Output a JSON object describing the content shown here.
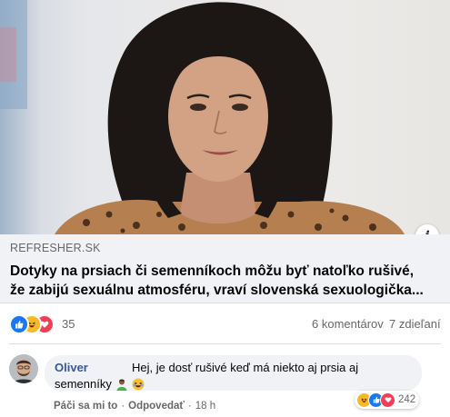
{
  "link_preview": {
    "source": "REFRESHER.SK",
    "headline_line1": "Dotyky na prsiach či semenníkoch môžu byť natoľko rušivé,",
    "headline_line2": "že zabijú sexuálnu atmosféru, vraví slovenská sexuologička..."
  },
  "post_stats": {
    "reaction_icons": [
      "like-icon",
      "haha-icon",
      "love-icon"
    ],
    "reaction_count": "35",
    "comments": "6 komentárov",
    "shares": "7 zdieľaní"
  },
  "comment": {
    "author": "Oliver",
    "text_line1": "Hej, je dosť rušivé keď má niekto aj prsia aj",
    "text_line2": "semenníky",
    "emojis": [
      "person-emoji",
      "laughing-emoji"
    ],
    "reaction_count": "242",
    "actions": {
      "like": "Páči sa mi to",
      "reply": "Odpovedať",
      "time": "18 h"
    }
  },
  "colors": {
    "like": "#1877f2",
    "haha": "#f7b928",
    "love": "#f33e58",
    "author": "#385898",
    "muted": "#65676b"
  }
}
